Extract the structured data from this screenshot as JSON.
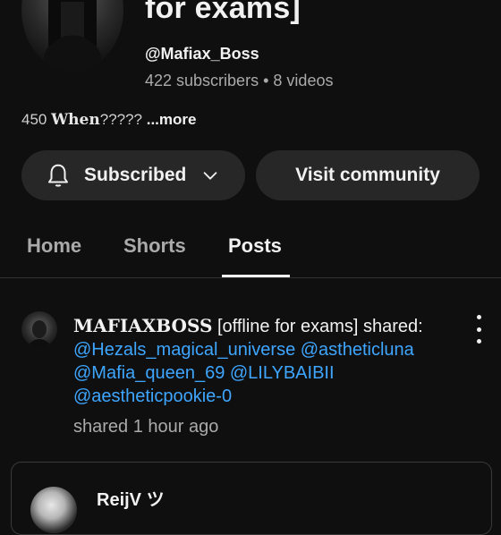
{
  "channel": {
    "title_fragment": "for exams]",
    "handle": "@Mafiax_Boss",
    "subscribers": "422 subscribers",
    "separator": "•",
    "videos": "8 videos",
    "description_prefix": "450 ",
    "description_bold": "When",
    "description_suffix": "????? ",
    "more_link": "...more"
  },
  "buttons": {
    "subscribed": "Subscribed",
    "visit_community": "Visit community"
  },
  "tabs": [
    {
      "label": "Home",
      "active": false
    },
    {
      "label": "Shorts",
      "active": false
    },
    {
      "label": "Posts",
      "active": true
    }
  ],
  "post": {
    "author": "MAFIAXBOSS",
    "author_suffix": " [offline for exams] shared:",
    "mentions": [
      "@Hezals_magical_universe @astheticluna",
      "@Mafia_queen_69 @LILYBAIBII",
      "@aestheticpookie-0"
    ],
    "time": "shared 1 hour ago"
  },
  "shared_card": {
    "author": "ReijV ツ"
  },
  "colors": {
    "background": "#0f0f0f",
    "pill": "#272727",
    "link": "#3ea6ff",
    "muted": "#aaaaaa"
  },
  "icons": {
    "subscribed": "bell-icon",
    "dropdown": "chevron-down-icon",
    "post_menu": "kebab-menu-icon"
  }
}
